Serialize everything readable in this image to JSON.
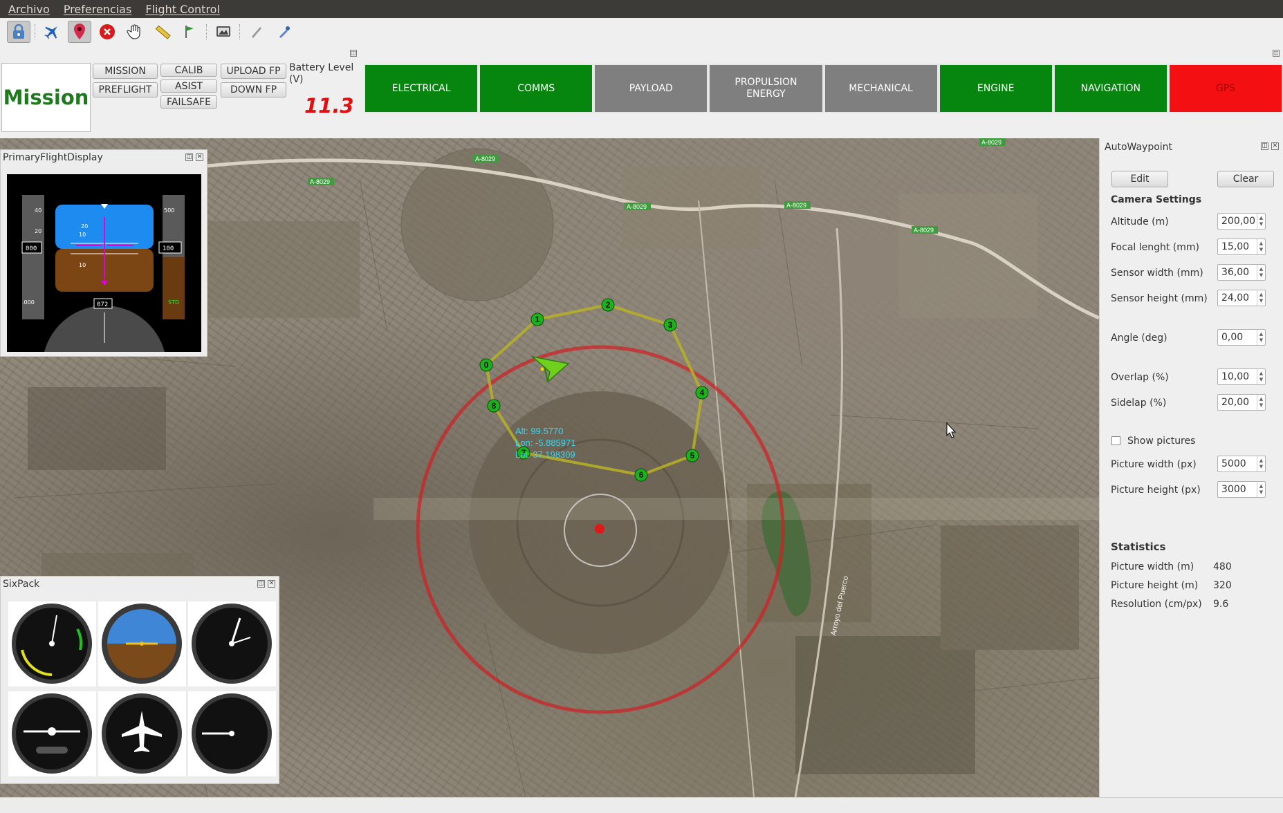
{
  "menu": [
    "Archivo",
    "Preferencias",
    "Flight Control"
  ],
  "toolbar": {
    "icons": [
      "lock-icon",
      "airplane-icon",
      "map-pin-icon",
      "stop-icon",
      "hand-icon",
      "ruler-icon",
      "flag-icon",
      "screenshot-icon",
      "feather-icon",
      "dropper-icon"
    ]
  },
  "mission": {
    "title": "Mission",
    "buttons": [
      "MISSION",
      "PREFLIGHT",
      "CALIB",
      "ASIST",
      "FAILSAFE",
      "UPLOAD FP",
      "DOWN FP"
    ]
  },
  "battery": {
    "label": "Battery Level (V)",
    "value": "11.3"
  },
  "status_tiles": [
    {
      "label": "ELECTRICAL",
      "state": "green"
    },
    {
      "label": "COMMS",
      "state": "green"
    },
    {
      "label": "PAYLOAD",
      "state": "gray"
    },
    {
      "label": "PROPULSION ENERGY",
      "state": "gray"
    },
    {
      "label": "MECHANICAL",
      "state": "gray"
    },
    {
      "label": "ENGINE",
      "state": "green"
    },
    {
      "label": "NAVIGATION",
      "state": "green"
    },
    {
      "label": "GPS",
      "state": "red"
    }
  ],
  "colors": {
    "ok": "#07860f",
    "warn": "#7f7f7f",
    "err": "#f40f12",
    "mission_text": "#1f7a1f",
    "battery": "#e01010"
  },
  "map": {
    "road_labels": [
      "A-8029",
      "A-8029",
      "A-8029",
      "A-8029",
      "A-8029",
      "A-8029",
      "A-8029"
    ],
    "stream_label": "Arroyo del Puerco",
    "waypoints": [
      "0",
      "1",
      "2",
      "3",
      "4",
      "5",
      "6",
      "7",
      "8"
    ],
    "telemetry": {
      "alt": "Alt: 99.5770",
      "lon": "Lon: -5.885971",
      "lat": "Lat: 37.198309"
    }
  },
  "pfd": {
    "title": "PrimaryFlightDisplay",
    "speed": "000",
    "altitude": "100",
    "heading": "072",
    "baro": ".000",
    "std": "STD",
    "speed_ticks": [
      "40",
      "20"
    ],
    "alt_ticks": [
      "500"
    ],
    "pitch_ticks": [
      "20",
      "10",
      "10"
    ]
  },
  "sixpack": {
    "title": "SixPack",
    "gauges": [
      "airspeed-gauge",
      "attitude-gauge",
      "altimeter-gauge",
      "turn-coordinator-gauge",
      "heading-gauge",
      "vertical-speed-gauge"
    ]
  },
  "autowaypoint": {
    "title": "AutoWaypoint",
    "edit": "Edit",
    "clear": "Clear",
    "camera_settings": "Camera Settings",
    "fields": [
      {
        "label": "Altitude (m)",
        "value": "200,00"
      },
      {
        "label": "Focal lenght (mm)",
        "value": "15,00"
      },
      {
        "label": "Sensor width (mm)",
        "value": "36,00"
      },
      {
        "label": "Sensor height (mm)",
        "value": "24,00"
      },
      {
        "label": "Angle (deg)",
        "value": "0,00"
      },
      {
        "label": "Overlap (%)",
        "value": "10,00"
      },
      {
        "label": "Sidelap (%)",
        "value": "20,00"
      }
    ],
    "show_pictures": "Show pictures",
    "picture_fields": [
      {
        "label": "Picture width (px)",
        "value": "5000"
      },
      {
        "label": "Picture height (px)",
        "value": "3000"
      }
    ],
    "statistics": "Statistics",
    "stats": [
      {
        "label": "Picture width (m)",
        "value": "480"
      },
      {
        "label": "Picture height (m)",
        "value": "320"
      },
      {
        "label": "Resolution (cm/px)",
        "value": "9.6"
      }
    ]
  }
}
